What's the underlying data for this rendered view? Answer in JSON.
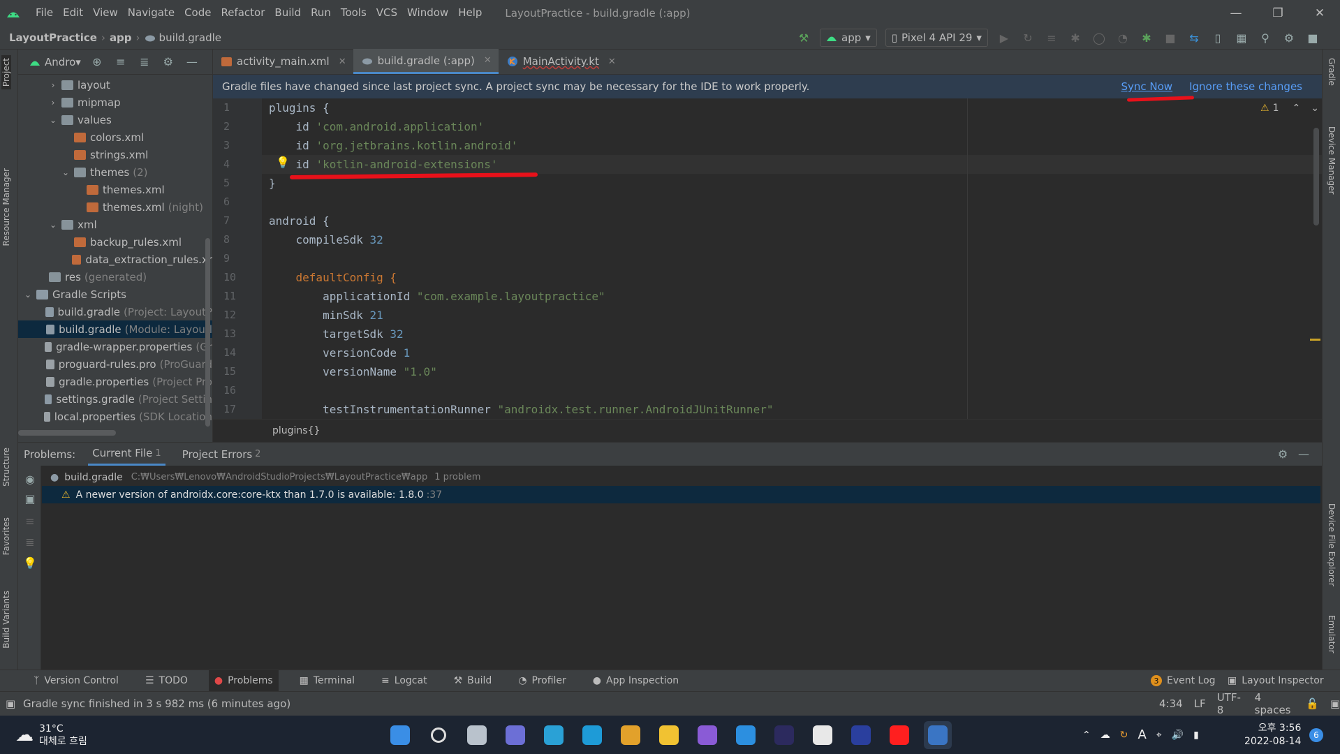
{
  "window": {
    "menu": [
      "File",
      "Edit",
      "View",
      "Navigate",
      "Code",
      "Refactor",
      "Build",
      "Run",
      "Tools",
      "VCS",
      "Window",
      "Help"
    ],
    "title": "LayoutPractice - build.gradle (:app)"
  },
  "nav": {
    "breadcrumb": [
      "LayoutPractice",
      "app",
      "build.gradle"
    ],
    "run_config": "app",
    "device": "Pixel 4 API 29"
  },
  "project_panel": {
    "view_label": "Andro▾",
    "tree": [
      {
        "label": "layout",
        "arrow": "›",
        "indent": 2,
        "icon": "folder"
      },
      {
        "label": "mipmap",
        "arrow": "›",
        "indent": 2,
        "icon": "folder"
      },
      {
        "label": "values",
        "arrow": "⌄",
        "indent": 2,
        "icon": "folder"
      },
      {
        "label": "colors.xml",
        "arrow": "",
        "indent": 3,
        "icon": "xml"
      },
      {
        "label": "strings.xml",
        "arrow": "",
        "indent": 3,
        "icon": "xml"
      },
      {
        "label": "themes",
        "dim": "(2)",
        "arrow": "⌄",
        "indent": 3,
        "icon": "folder"
      },
      {
        "label": "themes.xml",
        "arrow": "",
        "indent": 4,
        "icon": "xml"
      },
      {
        "label": "themes.xml",
        "dim": "(night)",
        "arrow": "",
        "indent": 4,
        "icon": "xml"
      },
      {
        "label": "xml",
        "arrow": "⌄",
        "indent": 2,
        "icon": "folder"
      },
      {
        "label": "backup_rules.xml",
        "arrow": "",
        "indent": 3,
        "icon": "xml"
      },
      {
        "label": "data_extraction_rules.xr",
        "arrow": "",
        "indent": 3,
        "icon": "xml"
      },
      {
        "label": "res",
        "dim": "(generated)",
        "arrow": "",
        "indent": 1,
        "icon": "folder"
      },
      {
        "label": "Gradle Scripts",
        "arrow": "⌄",
        "indent": 0,
        "icon": "gradle"
      },
      {
        "label": "build.gradle",
        "dim": "(Project: LayoutP",
        "arrow": "",
        "indent": 1,
        "icon": "gradle"
      },
      {
        "label": "build.gradle",
        "dim": "(Module: Layoutl",
        "arrow": "",
        "indent": 1,
        "icon": "gradle",
        "selected": true
      },
      {
        "label": "gradle-wrapper.properties",
        "dim": "(Gr",
        "arrow": "",
        "indent": 1,
        "icon": "prop"
      },
      {
        "label": "proguard-rules.pro",
        "dim": "(ProGuard",
        "arrow": "",
        "indent": 1,
        "icon": "prop"
      },
      {
        "label": "gradle.properties",
        "dim": "(Project Pro",
        "arrow": "",
        "indent": 1,
        "icon": "prop"
      },
      {
        "label": "settings.gradle",
        "dim": "(Project Settin",
        "arrow": "",
        "indent": 1,
        "icon": "gradle"
      },
      {
        "label": "local.properties",
        "dim": "(SDK Location",
        "arrow": "",
        "indent": 1,
        "icon": "prop"
      }
    ]
  },
  "side_tabs": {
    "left": [
      "Project",
      "Resource Manager",
      "Structure",
      "Favorites",
      "Build Variants"
    ],
    "right": [
      "Gradle",
      "Device Manager",
      "Device File Explorer",
      "Emulator"
    ]
  },
  "editor": {
    "tabs": [
      {
        "label": "activity_main.xml",
        "active": false
      },
      {
        "label": "build.gradle (:app)",
        "active": true
      },
      {
        "label": "MainActivity.kt",
        "active": false
      }
    ],
    "banner": "Gradle files have changed since last project sync. A project sync may be necessary for the IDE to work properly.",
    "sync_now": "Sync Now",
    "ignore": "Ignore these changes",
    "warning_count": "1",
    "line_numbers": [
      "1",
      "2",
      "3",
      "4",
      "5",
      "6",
      "7",
      "8",
      "9",
      "10",
      "11",
      "12",
      "13",
      "14",
      "15",
      "16",
      "17"
    ],
    "code": [
      [
        {
          "t": "plugins {",
          "c": ""
        }
      ],
      [
        {
          "t": "    id ",
          "c": ""
        },
        {
          "t": "'com.android.application'",
          "c": "str"
        }
      ],
      [
        {
          "t": "    id ",
          "c": ""
        },
        {
          "t": "'org.jetbrains.kotlin.android'",
          "c": "str"
        }
      ],
      [
        {
          "t": "    id ",
          "c": ""
        },
        {
          "t": "'kotlin-android-extensions'",
          "c": "str"
        }
      ],
      [
        {
          "t": "}",
          "c": ""
        }
      ],
      [
        {
          "t": "",
          "c": ""
        }
      ],
      [
        {
          "t": "android {",
          "c": ""
        }
      ],
      [
        {
          "t": "    compileSdk ",
          "c": ""
        },
        {
          "t": "32",
          "c": "num"
        }
      ],
      [
        {
          "t": "",
          "c": ""
        }
      ],
      [
        {
          "t": "    defaultConfig {",
          "c": "kw"
        }
      ],
      [
        {
          "t": "        applicationId ",
          "c": ""
        },
        {
          "t": "\"com.example.layoutpractice\"",
          "c": "str"
        }
      ],
      [
        {
          "t": "        minSdk ",
          "c": ""
        },
        {
          "t": "21",
          "c": "num"
        }
      ],
      [
        {
          "t": "        targetSdk ",
          "c": ""
        },
        {
          "t": "32",
          "c": "num"
        }
      ],
      [
        {
          "t": "        versionCode ",
          "c": ""
        },
        {
          "t": "1",
          "c": "num"
        }
      ],
      [
        {
          "t": "        versionName ",
          "c": ""
        },
        {
          "t": "\"1.0\"",
          "c": "str"
        }
      ],
      [
        {
          "t": "",
          "c": ""
        }
      ],
      [
        {
          "t": "        testInstrumentationRunner ",
          "c": ""
        },
        {
          "t": "\"androidx.test.runner.AndroidJUnitRunner\"",
          "c": "str"
        }
      ]
    ],
    "breadcrumb": "plugins{}"
  },
  "problems": {
    "label": "Problems:",
    "tabs": [
      {
        "label": "Current File",
        "count": "1"
      },
      {
        "label": "Project Errors",
        "count": "2"
      }
    ],
    "file": "build.gradle",
    "path": "C:₩Users₩Lenovo₩AndroidStudioProjects₩LayoutPractice₩app",
    "summary": "1 problem",
    "message": "A newer version of androidx.core:core-ktx than 1.7.0 is available: 1.8.0",
    "location": ":37"
  },
  "bottom_tools": [
    "Version Control",
    "TODO",
    "Problems",
    "Terminal",
    "Logcat",
    "Build",
    "Profiler",
    "App Inspection"
  ],
  "bottom_right": {
    "event_log": "Event Log",
    "event_count": "3",
    "layout_inspector": "Layout Inspector"
  },
  "status": {
    "message": "Gradle sync finished in 3 s 982 ms (6 minutes ago)",
    "position": "4:34",
    "line_sep": "LF",
    "encoding": "UTF-8",
    "indent": "4 spaces"
  },
  "taskbar": {
    "weather_temp": "31°C",
    "weather_desc": "대체로 흐림",
    "ime": "A",
    "time": "오후 3:56",
    "date": "2022-08-14",
    "notif": "6",
    "apps": [
      {
        "name": "windows-start-icon",
        "color": "#3a8ee6"
      },
      {
        "name": "search-icon",
        "color": "#1c2431"
      },
      {
        "name": "task-view-icon",
        "color": "#b9c2cc"
      },
      {
        "name": "teams-chat-icon",
        "color": "#6c6fd6"
      },
      {
        "name": "desktop-icon",
        "color": "#2aa1d6"
      },
      {
        "name": "edge-icon",
        "color": "#1e9bd7"
      },
      {
        "name": "chrome-icon",
        "color": "#e2a12b"
      },
      {
        "name": "file-explorer-icon",
        "color": "#f1c232"
      },
      {
        "name": "visual-studio-icon",
        "color": "#8a5bd6"
      },
      {
        "name": "vscode-icon",
        "color": "#2c8fe0"
      },
      {
        "name": "eclipse-icon",
        "color": "#2c2a5e"
      },
      {
        "name": "python-icon",
        "color": "#e8e8e8"
      },
      {
        "name": "devcpp-icon",
        "color": "#2a3f9e"
      },
      {
        "name": "youtube-music-icon",
        "color": "#ff1f1f"
      },
      {
        "name": "android-studio-icon",
        "color": "#3a75c4"
      }
    ]
  },
  "colors": {
    "accent": "#4a88c7",
    "annotation": "#e8111a",
    "link": "#589df6"
  }
}
